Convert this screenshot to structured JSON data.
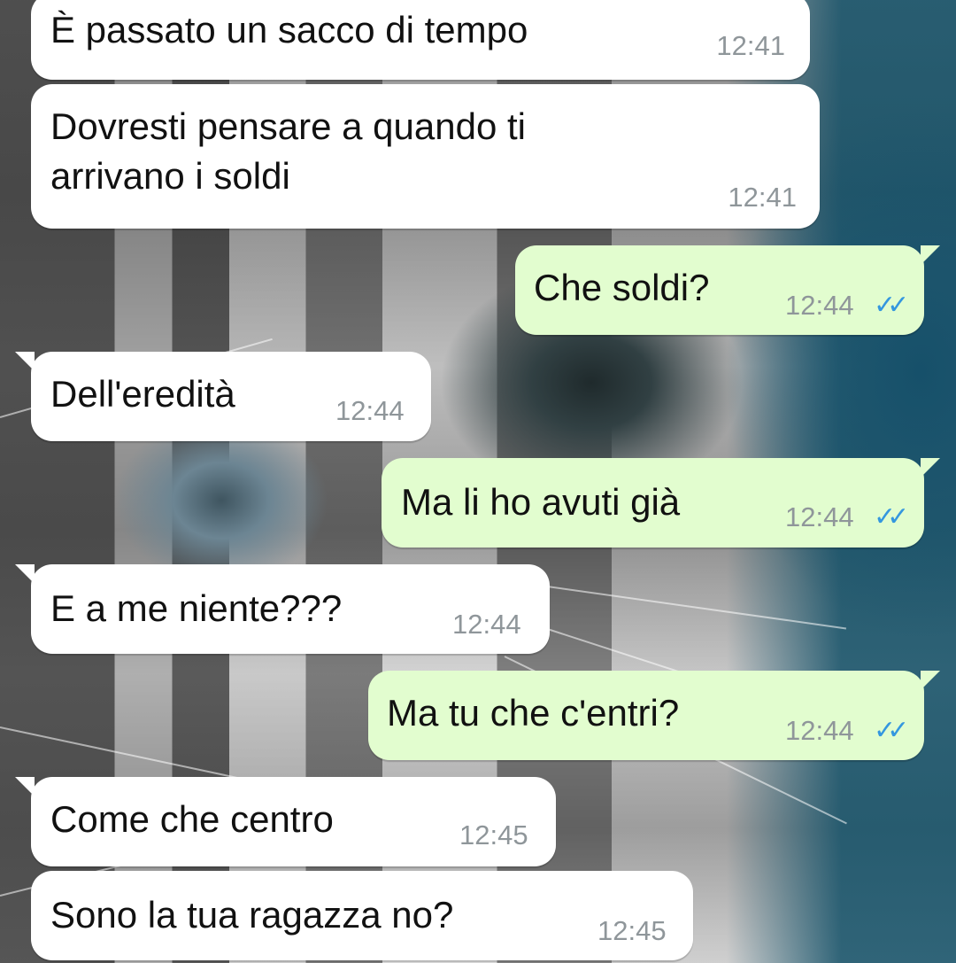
{
  "chat": {
    "background_icon": "kitten-photo-wallpaper",
    "messages": [
      {
        "direction": "incoming",
        "text": "È passato un sacco di tempo",
        "time": "12:41"
      },
      {
        "direction": "incoming",
        "text": "Dovresti pensare a quando ti\narrivano i soldi",
        "time": "12:41"
      },
      {
        "direction": "outgoing",
        "text": "Che soldi?",
        "time": "12:44",
        "status_icon": "double-check-icon"
      },
      {
        "direction": "incoming",
        "text": "Dell'eredità",
        "time": "12:44"
      },
      {
        "direction": "outgoing",
        "text": "Ma li ho avuti già",
        "time": "12:44",
        "status_icon": "double-check-icon"
      },
      {
        "direction": "incoming",
        "text": "E a me niente???",
        "time": "12:44"
      },
      {
        "direction": "outgoing",
        "text": "Ma tu che c'entri?",
        "time": "12:44",
        "status_icon": "double-check-icon"
      },
      {
        "direction": "incoming",
        "text": "Come che centro",
        "time": "12:45"
      },
      {
        "direction": "incoming",
        "text": "Sono la tua ragazza no?",
        "time": "12:45"
      }
    ]
  },
  "colors": {
    "incoming_bubble": "#ffffff",
    "outgoing_bubble": "#e2fdcf",
    "read_ticks": "#3497df",
    "timestamp": "#8f969a"
  }
}
